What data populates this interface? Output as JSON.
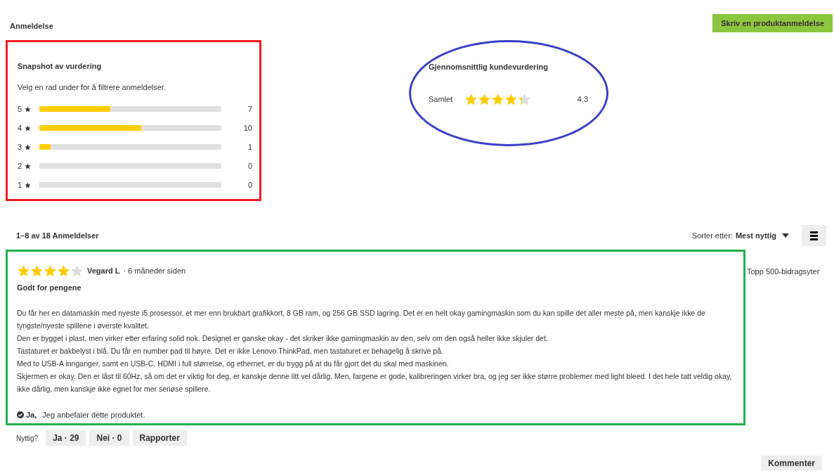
{
  "header": {
    "title": "Anmeldelse",
    "write_button": "Skriv en produktanmeldelse"
  },
  "snapshot": {
    "title": "Snapshot av vurdering",
    "hint": "Velg en rad under for å filtrere anmeldelser.",
    "rows": [
      {
        "label": "5",
        "level": 0.39,
        "count": "7"
      },
      {
        "label": "4",
        "level": 0.56,
        "count": "10"
      },
      {
        "label": "3",
        "level": 0.06,
        "count": "1"
      },
      {
        "label": "2",
        "level": 0,
        "count": "0"
      },
      {
        "label": "1",
        "level": 0,
        "count": "0"
      }
    ]
  },
  "average": {
    "title": "Gjennomsnittlig kundevurdering",
    "label": "Samlet",
    "stars": 4.3,
    "value": "4.3"
  },
  "list": {
    "count": "1–8 av 18 Anmeldelser",
    "sort_label": "Sorter etter:",
    "sort_value": "Mest nyttig"
  },
  "review": {
    "stars": 4,
    "author": "Vegard L",
    "time": "· 6 måneder siden",
    "title": "Godt for pengene",
    "badge": "Topp 500-bidragsyter",
    "paragraphs": [
      "Du får her en datamaskin med nyeste i5 prosessor, et mer enn brukbart grafikkort, 8 GB ram, og 256 GB SSD lagring. Det er en helt okay gamingmaskin som du kan spille det aller meste på, men kanskje ikke de tyngste/nyeste spillene i øverste kvalitet.",
      "Den er bygget i plast, men virker etter erfaring solid nok. Designet er ganske okay - det skriker ikke gamingmaskin av den, selv om den også heller ikke skjuler det.",
      "Tastaturet er bakbelyst i blå. Du får en number pad til høyre. Det er ikke Lenovo ThinkPad, men tastaturet er behagelig å skrive på.",
      "Med to USB-A innganger, samt en USB-C, HDMI i full størrelse, og ethernet, er du trygg på at du får gjort det du skal med maskinen.",
      "Skjermen er okay. Den er låst til 60Hz, så om det er viktig for deg, er kanskje denne litt vel dårlig. Men, fargene er gode, kalibreringen virker bra, og jeg ser ikke større problemer med light bleed. I det hele tatt veldig okay, ikke dårlig, men kanskje ikke egnet for mer seriøse spillere."
    ],
    "recommend": {
      "answer": "Ja,",
      "text": "Jeg anbefaler dette produktet."
    },
    "helpful_label": "Nyttig?",
    "buttons": [
      "Ja · 29",
      "Nei · 0",
      "Rapporter"
    ],
    "comment_button": "Kommenter"
  }
}
